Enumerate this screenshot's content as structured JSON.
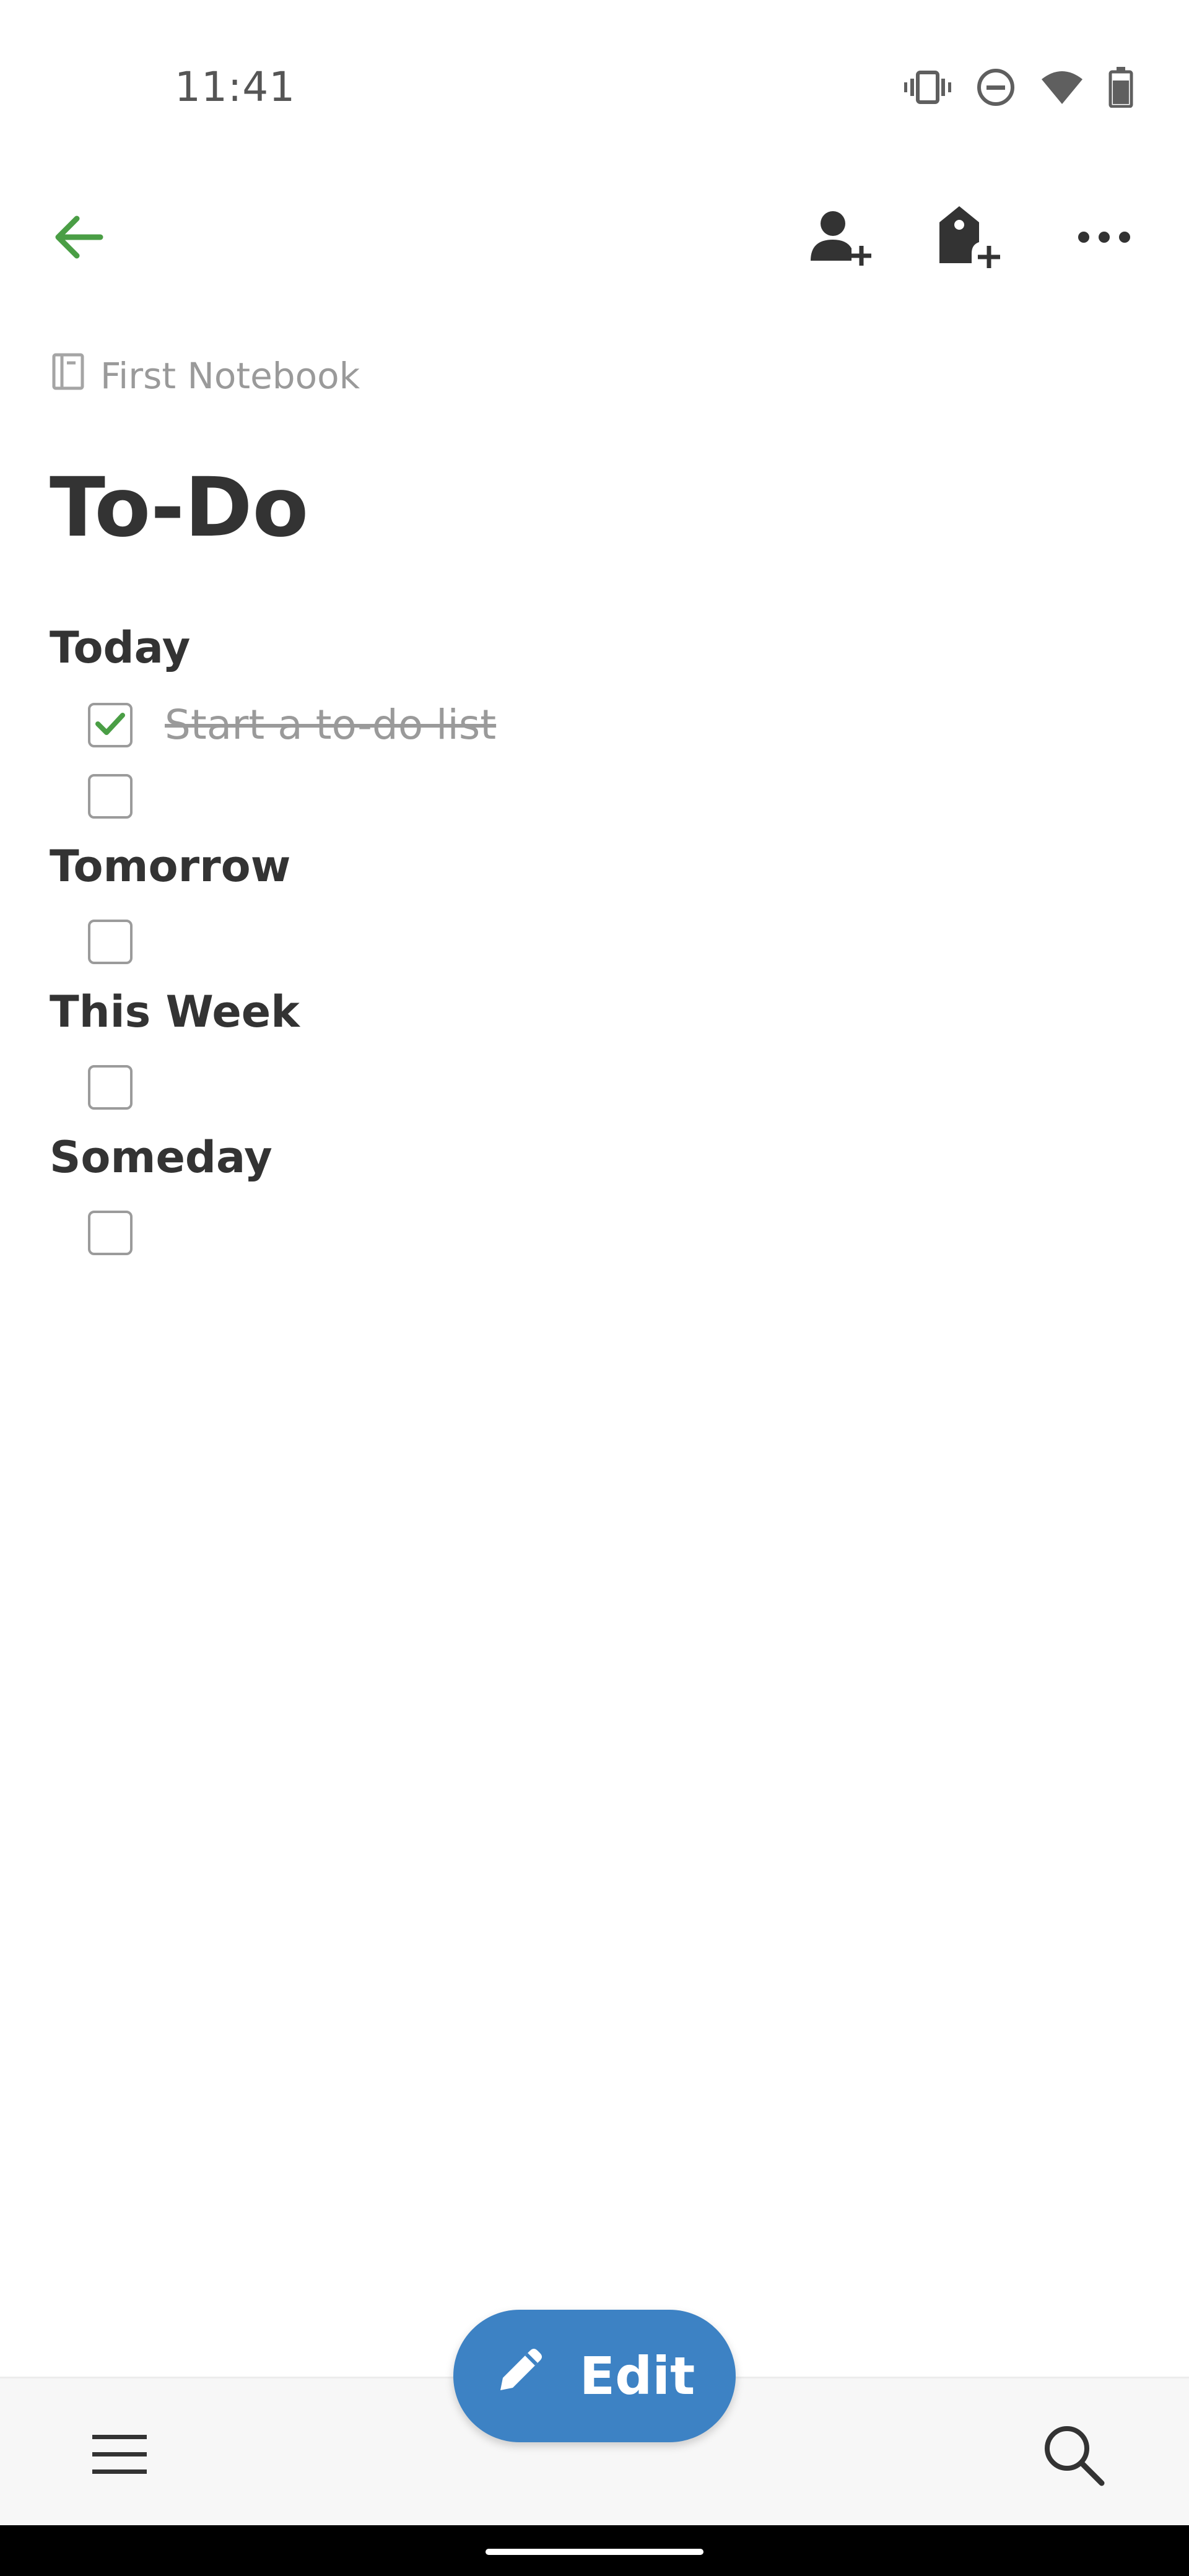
{
  "status_bar": {
    "time": "11:41",
    "icons": [
      "vibrate-icon",
      "do-not-disturb-icon",
      "wifi-icon",
      "battery-icon"
    ]
  },
  "toolbar": {
    "back_icon": "arrow-left-icon",
    "share_icon": "add-person-icon",
    "tag_icon": "add-tag-icon",
    "more_icon": "more-horizontal-icon",
    "accent_color": "#4a9e45"
  },
  "note": {
    "notebook": "First Notebook",
    "title": "To-Do",
    "sections": [
      {
        "heading": "Today",
        "items": [
          {
            "text": "Start a to-do list",
            "checked": true
          },
          {
            "text": "",
            "checked": false
          }
        ]
      },
      {
        "heading": "Tomorrow",
        "items": [
          {
            "text": "",
            "checked": false
          }
        ]
      },
      {
        "heading": "This Week",
        "items": [
          {
            "text": "",
            "checked": false
          }
        ]
      },
      {
        "heading": "Someday",
        "items": [
          {
            "text": "",
            "checked": false
          }
        ]
      }
    ]
  },
  "fab": {
    "label": "Edit",
    "icon": "pencil-icon",
    "color": "#3d82c4"
  },
  "bottom_bar": {
    "menu_icon": "hamburger-menu-icon",
    "search_icon": "search-icon"
  }
}
